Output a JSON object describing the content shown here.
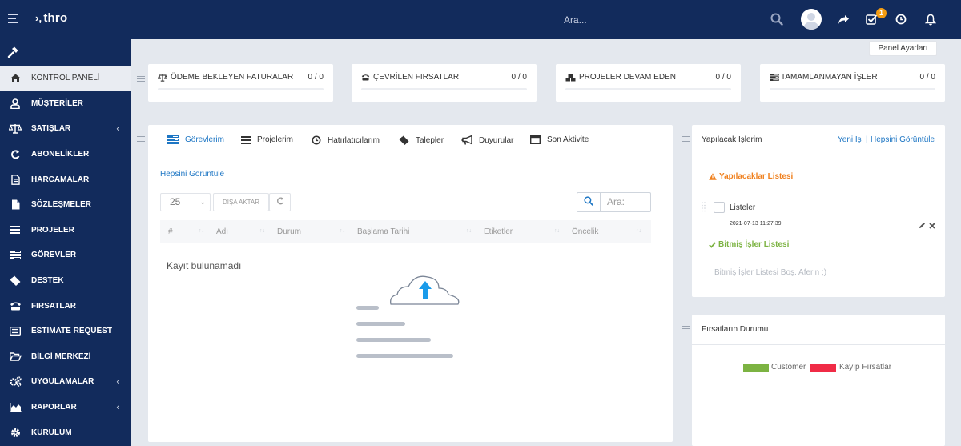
{
  "topbar": {
    "logo": "thro",
    "search_placeholder": "Ara...",
    "notification_count": "1",
    "colors": {
      "bg": "#122b5c",
      "badge": "#f39c12"
    }
  },
  "sidebar": {
    "items": [
      {
        "label": "KONTROL PANELİ",
        "icon": "home-icon",
        "active": true
      },
      {
        "label": "MÜŞTERİLER",
        "icon": "user-icon"
      },
      {
        "label": "SATIŞLAR",
        "icon": "balance-scale-icon",
        "has_submenu": true
      },
      {
        "label": "ABONELİKLER",
        "icon": "refresh-icon"
      },
      {
        "label": "HARCAMALAR",
        "icon": "file-text-icon"
      },
      {
        "label": "SÖZLEŞMELER",
        "icon": "file-icon"
      },
      {
        "label": "PROJELER",
        "icon": "bars-icon"
      },
      {
        "label": "GÖREVLER",
        "icon": "tasks-icon"
      },
      {
        "label": "DESTEK",
        "icon": "ticket-icon"
      },
      {
        "label": "FIRSATLAR",
        "icon": "tty-icon"
      },
      {
        "label": "ESTIMATE REQUEST",
        "icon": "list-alt-icon"
      },
      {
        "label": "BİLGİ MERKEZİ",
        "icon": "folder-open-icon"
      },
      {
        "label": "UYGULAMALAR",
        "icon": "cogs-icon",
        "has_submenu": true
      },
      {
        "label": "RAPORLAR",
        "icon": "area-chart-icon",
        "has_submenu": true
      },
      {
        "label": "KURULUM",
        "icon": "cog-icon"
      }
    ],
    "submenu_arrow": "‹"
  },
  "panel_settings": "Panel Ayarları",
  "stats": [
    {
      "label": "ÖDEME BEKLEYEN FATURALAR",
      "value": "0 / 0",
      "icon": "balance-scale-icon"
    },
    {
      "label": "ÇEVRİLEN FIRSATLAR",
      "value": "0 / 0",
      "icon": "tty-icon"
    },
    {
      "label": "PROJELER DEVAM EDEN",
      "value": "0 / 0",
      "icon": "cubes-icon"
    },
    {
      "label": "TAMAMLANMAYAN İŞLER",
      "value": "0 / 0",
      "icon": "tasks-icon"
    }
  ],
  "main": {
    "tabs": [
      {
        "label": "Görevlerim",
        "icon": "tasks-icon",
        "active": true
      },
      {
        "label": "Projelerim",
        "icon": "bars-icon"
      },
      {
        "label": "Hatırlatıcılarım",
        "icon": "clock-icon"
      },
      {
        "label": "Talepler",
        "icon": "ticket-icon"
      },
      {
        "label": "Duyurular",
        "icon": "bullhorn-icon"
      },
      {
        "label": "Son Aktivite",
        "icon": "window-icon"
      }
    ],
    "view_all": "Hepsini Görüntüle",
    "page_length": "25",
    "export_label": "DIŞA AKTAR",
    "search_placeholder": "Ara:",
    "columns": [
      "#",
      "Adı",
      "Durum",
      "Başlama Tarihi",
      "Etiketler",
      "Öncelik"
    ],
    "empty_text": "Kayıt bulunamadı"
  },
  "todo": {
    "title": "Yapılacak İşlerim",
    "new_link": "Yeni İş",
    "separator": "|",
    "view_all": "Hepsini Görüntüle",
    "pending_title": "Yapılacaklar Listesi",
    "item_text": "Listeler",
    "item_date": "2021-07-13 11:27:39",
    "done_title": "Bitmiş İşler Listesi",
    "done_empty": "Bitmiş İşler Listesi Boş. Aferin ;)",
    "colors": {
      "warning": "#f0801e",
      "success": "#7cb342"
    }
  },
  "leads": {
    "title": "Fırsatların Durumu",
    "legend": [
      {
        "label": "Customer",
        "color": "#7cb342"
      },
      {
        "label": "Kayıp Fırsatlar",
        "color": "#f02b46"
      }
    ]
  }
}
